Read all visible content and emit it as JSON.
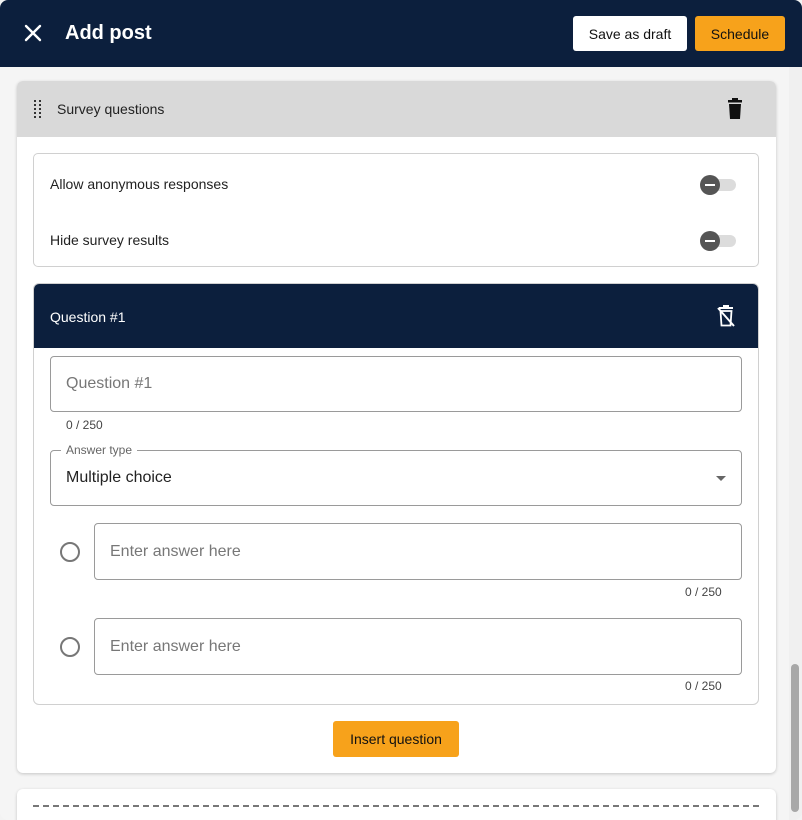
{
  "header": {
    "title": "Add post",
    "save_draft_label": "Save as draft",
    "schedule_label": "Schedule",
    "close_icon": "close-icon"
  },
  "colors": {
    "header_bg": "#0c1f3d",
    "accent": "#f7a21b",
    "section_head_bg": "#d9d9d9"
  },
  "survey": {
    "title": "Survey questions",
    "settings": [
      {
        "label": "Allow anonymous responses",
        "enabled": false
      },
      {
        "label": "Hide survey results",
        "enabled": false
      }
    ],
    "question": {
      "title": "Question #1",
      "text_placeholder": "Question #1",
      "text_value": "",
      "text_counter": "0 / 250",
      "answer_type_label": "Answer type",
      "answer_type_value": "Multiple choice",
      "answers": [
        {
          "placeholder": "Enter answer here",
          "value": "",
          "counter": "0 / 250"
        },
        {
          "placeholder": "Enter answer here",
          "value": "",
          "counter": "0 / 250"
        }
      ]
    },
    "insert_label": "Insert question"
  }
}
